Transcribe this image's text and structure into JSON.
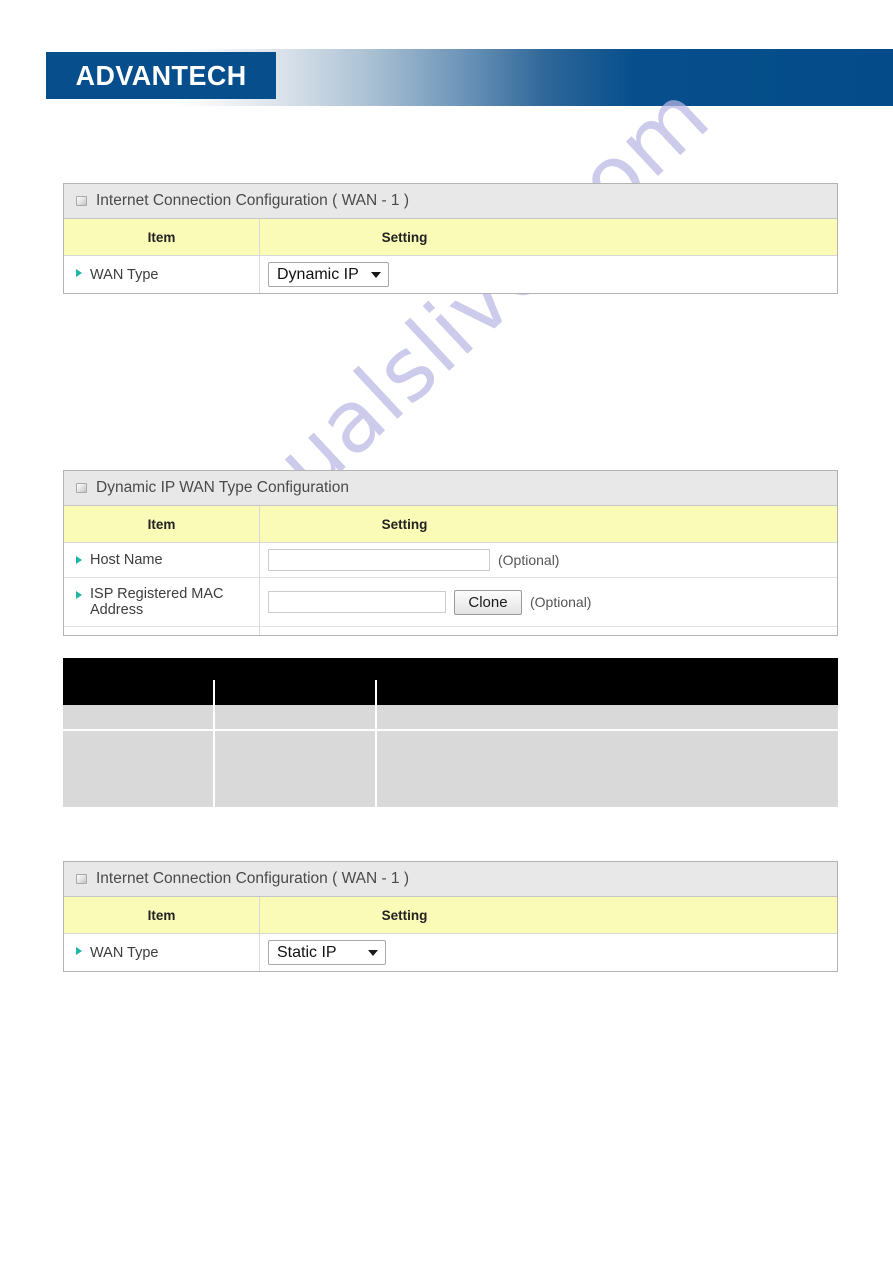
{
  "header": {
    "logo_text": "ADVANTECH",
    "logo_bg_color": "#064f8c"
  },
  "watermark": {
    "text": "manualslive.com",
    "color": "#b9b8e4"
  },
  "sections": {
    "wan_config_top": {
      "title": "Internet Connection Configuration ( WAN - 1 )",
      "collapse_icon": "box-icon",
      "columns": {
        "item": "Item",
        "setting": "Setting"
      },
      "rows": [
        {
          "label": "WAN Type",
          "bullet_icon": "green-arrow-icon",
          "control": "dropdown",
          "value": "Dynamic IP"
        }
      ]
    },
    "dynamic_ip_config": {
      "title": "Dynamic IP WAN Type Configuration",
      "collapse_icon": "box-icon",
      "columns": {
        "item": "Item",
        "setting": "Setting"
      },
      "rows": [
        {
          "label": "Host Name",
          "bullet_icon": "green-arrow-icon",
          "control": "text-input",
          "value": "",
          "note": "(Optional)"
        },
        {
          "label": "ISP Registered MAC Address",
          "bullet_icon": "green-arrow-icon",
          "control": "text-input-with-button",
          "value": "",
          "button_label": "Clone",
          "note": "(Optional)"
        }
      ]
    },
    "redacted_table": {
      "title": "",
      "columns": [
        "",
        "",
        ""
      ],
      "rows": [
        [
          "",
          "",
          ""
        ],
        [
          "",
          "",
          ""
        ]
      ]
    },
    "wan_config_bottom": {
      "title": "Internet Connection Configuration ( WAN - 1 )",
      "collapse_icon": "box-icon",
      "columns": {
        "item": "Item",
        "setting": "Setting"
      },
      "rows": [
        {
          "label": "WAN Type",
          "bullet_icon": "green-arrow-icon",
          "control": "dropdown",
          "value": "Static IP"
        }
      ]
    }
  }
}
